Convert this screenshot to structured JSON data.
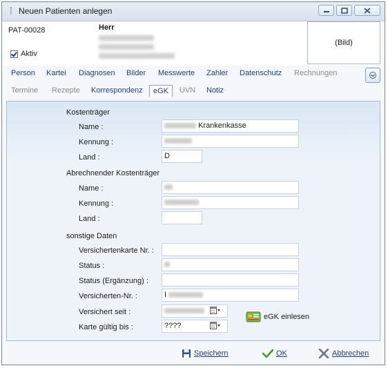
{
  "window": {
    "title": "Neuen Patienten anlegen"
  },
  "header": {
    "patient_id": "PAT-00028",
    "salutation": "Herr",
    "active_label": "Aktiv",
    "image_placeholder": "(Bild)"
  },
  "tabs_row1": [
    "Person",
    "Kartei",
    "Diagnosen",
    "Bilder",
    "Messwerte",
    "Zahler",
    "Datenschutz",
    "Rechnungen"
  ],
  "tabs_row2": [
    "Termine",
    "Rezepte",
    "Korrespondenz",
    "eGK",
    "UVN",
    "Notiz"
  ],
  "form": {
    "kostentraeger": {
      "heading": "Kostenträger",
      "name_label": "Name :",
      "name_value": "Krankenkasse",
      "kennung_label": "Kennung :",
      "land_label": "Land :",
      "land_value": "D"
    },
    "abrechnender": {
      "heading": "Abrechnender Kostenträger",
      "name_label": "Name :",
      "kennung_label": "Kennung :",
      "land_label": "Land :"
    },
    "sonstige": {
      "heading": "sonstige Daten",
      "karte_label": "Versichertenkarte Nr. :",
      "status_label": "Status :",
      "status_erg_label": "Status (Ergänzung) :",
      "versnr_label": "Versicherten-Nr. :",
      "versnr_prefix": "I",
      "versichert_seit_label": "Versichert seit :",
      "karte_gueltig_label": "Karte gültig bis :",
      "karte_gueltig_value": "????"
    },
    "egk_button": "eGK einlesen"
  },
  "footer": {
    "save": "Speichern",
    "ok": "OK",
    "cancel": "Abbrechen"
  }
}
